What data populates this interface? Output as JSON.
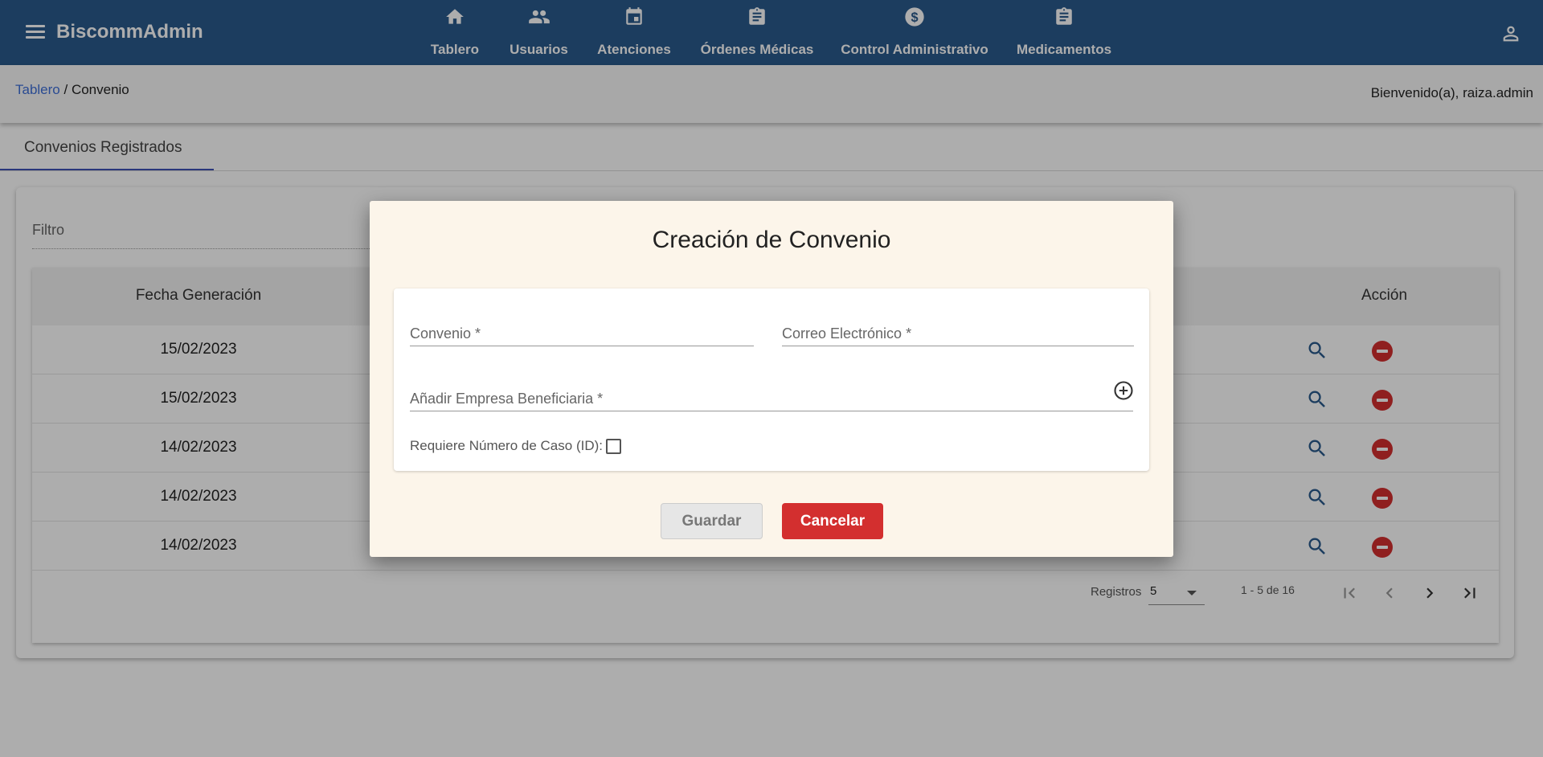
{
  "app": {
    "brand": "BiscommAdmin",
    "menu_icon": "menu-icon",
    "user_icon": "person-icon",
    "colors": {
      "header": "#2a5a8c",
      "accent": "#3f51b5",
      "danger": "#d32f2f",
      "dialog_bg": "#fcf5ea"
    }
  },
  "nav": {
    "items": [
      {
        "label": "Tablero",
        "icon": "home-icon"
      },
      {
        "label": "Usuarios",
        "icon": "people-icon"
      },
      {
        "label": "Atenciones",
        "icon": "calendar-icon"
      },
      {
        "label": "Órdenes Médicas",
        "icon": "clipboard-icon"
      },
      {
        "label": "Control Administrativo",
        "icon": "dollar-icon"
      },
      {
        "label": "Medicamentos",
        "icon": "clipboard-icon"
      }
    ]
  },
  "breadcrumb": {
    "link": "Tablero",
    "separator": " / ",
    "current": "Convenio"
  },
  "welcome": "Bienvenido(a), raiza.admin",
  "tabs": [
    {
      "label": "Convenios Registrados"
    }
  ],
  "filter": {
    "placeholder": "Filtro",
    "value": ""
  },
  "table": {
    "columns": {
      "date": "Fecha Generación",
      "action": "Acción"
    },
    "rows": [
      {
        "date": "15/02/2023"
      },
      {
        "date": "15/02/2023"
      },
      {
        "date": "14/02/2023"
      },
      {
        "date": "14/02/2023"
      },
      {
        "date": "14/02/2023"
      }
    ],
    "row_actions": {
      "view_icon": "search-icon",
      "delete_icon": "remove-circle-icon"
    }
  },
  "paginator": {
    "label": "Registros",
    "page_size": "5",
    "range": "1 - 5 de 16",
    "buttons": [
      "first-page-icon",
      "previous-page-icon",
      "next-page-icon",
      "last-page-icon"
    ]
  },
  "dialog": {
    "title": "Creación de Convenio",
    "fields": {
      "convenio": {
        "placeholder": "Convenio *",
        "value": ""
      },
      "email": {
        "placeholder": "Correo Electrónico *",
        "value": ""
      },
      "empresa": {
        "placeholder": "Añadir Empresa Beneficiaria *",
        "value": ""
      }
    },
    "add_icon": "add-circle-icon",
    "checkbox": {
      "label": "Requiere Número de Caso (ID):",
      "checked": false
    },
    "save_label": "Guardar",
    "cancel_label": "Cancelar"
  }
}
